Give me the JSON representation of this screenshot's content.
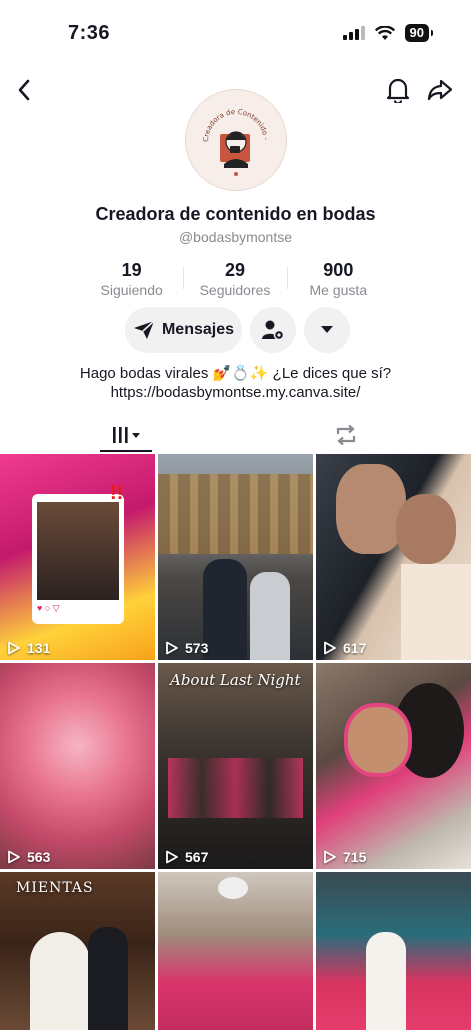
{
  "status_bar": {
    "time": "7:36",
    "battery": "90"
  },
  "profile": {
    "display_name": "Creadora de contenido en bodas",
    "username": "@bodasbymontse",
    "avatar_text": "Creadora de Contenido - bodas"
  },
  "stats": [
    {
      "value": "19",
      "label": "Siguiendo"
    },
    {
      "value": "29",
      "label": "Seguidores"
    },
    {
      "value": "900",
      "label": "Me gusta"
    }
  ],
  "actions": {
    "message_label": "Mensajes"
  },
  "bio": {
    "text": "Hago bodas virales 💅💍✨ ¿Le dices que sí?",
    "link": "https://bodasbymontse.my.canva.site/"
  },
  "videos": [
    {
      "views": "131"
    },
    {
      "views": "573"
    },
    {
      "views": "617"
    },
    {
      "views": "563"
    },
    {
      "views": "567",
      "overlay": "About Last Night"
    },
    {
      "views": "715"
    },
    {
      "views": "",
      "overlay": "MIENTAS"
    },
    {
      "views": ""
    },
    {
      "views": ""
    }
  ],
  "colors": {
    "text": "#161823",
    "muted": "#8a8b91",
    "button_bg": "#f1f1f2"
  }
}
